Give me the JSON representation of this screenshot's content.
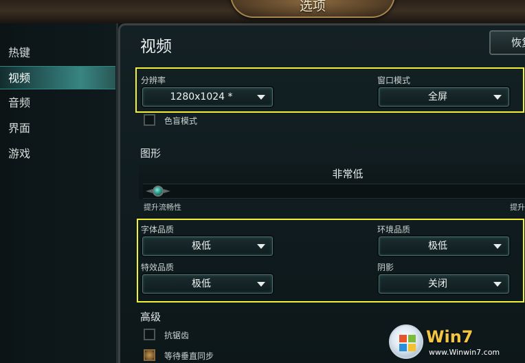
{
  "window": {
    "title": "选项"
  },
  "sidebar": {
    "items": [
      {
        "label": "热键",
        "active": false
      },
      {
        "label": "视频",
        "active": true
      },
      {
        "label": "音频",
        "active": false
      },
      {
        "label": "界面",
        "active": false
      },
      {
        "label": "游戏",
        "active": false
      }
    ]
  },
  "main": {
    "title": "视频",
    "restore_label": "恢复",
    "resolution": {
      "label": "分辨率",
      "value": "1280x1024 *"
    },
    "window_mode": {
      "label": "窗口模式",
      "value": "全屏"
    },
    "colorblind": {
      "label": "色盲模式",
      "checked": false
    },
    "graphics": {
      "title": "图形",
      "level_value": "非常低",
      "slider_fraction": 0.0,
      "left_label": "提升流畅性",
      "right_label": "提升"
    },
    "quality": {
      "text": {
        "label": "字体品质",
        "value": "极低"
      },
      "environment": {
        "label": "环境品质",
        "value": "极低"
      },
      "effects": {
        "label": "特效品质",
        "value": "极低"
      },
      "shadows": {
        "label": "阴影",
        "value": "关闭"
      }
    },
    "advanced": {
      "title": "高级",
      "antialias": {
        "label": "抗锯齿",
        "checked": false
      },
      "vsync": {
        "label": "等待垂直同步",
        "checked": true
      }
    }
  },
  "watermark": {
    "brand": "Win7",
    "url": "www.Winwin7.com"
  },
  "colors": {
    "highlight": "#f4f232",
    "active_tab": "#46aaa5",
    "accent_gold": "#c89a52"
  },
  "icons": {
    "dropdown_arrow": "chevron-down-icon",
    "slider_thumb": "gem-slider-thumb-icon",
    "watermark_logo": "windows-logo-icon"
  }
}
